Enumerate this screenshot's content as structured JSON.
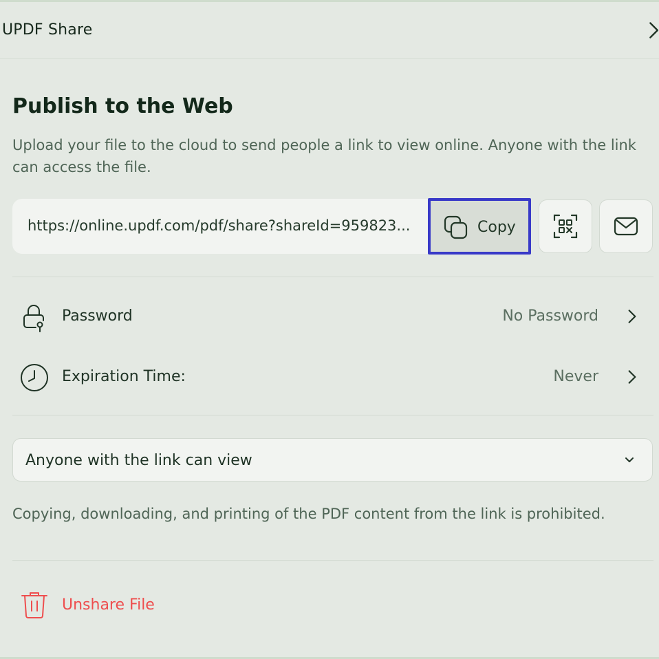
{
  "header": {
    "title": "UPDF Share",
    "chevron_icon": "chevron-right-icon"
  },
  "publish": {
    "title": "Publish to the Web",
    "description": "Upload your file to the cloud to send people a link to view online. Anyone with the link can access the file.",
    "link_value": "https://online.updf.com/pdf/share?shareId=959823...",
    "copy_label": "Copy",
    "copy_icon": "copy-icon",
    "qr_icon": "qr-code-icon",
    "mail_icon": "mail-icon"
  },
  "settings": {
    "password": {
      "label": "Password",
      "value": "No Password",
      "icon": "lock-icon"
    },
    "expiration": {
      "label": "Expiration Time:",
      "value": "Never",
      "icon": "clock-icon"
    }
  },
  "permissions": {
    "selected": "Anyone with the link can view",
    "notice": "Copying, downloading, and printing of the PDF content from the link is prohibited."
  },
  "unshare": {
    "label": "Unshare File",
    "icon": "trash-icon"
  },
  "colors": {
    "background": "#e4e9e3",
    "highlight": "#3839c8",
    "danger": "#ee4e4e",
    "text": "#1f3325"
  }
}
